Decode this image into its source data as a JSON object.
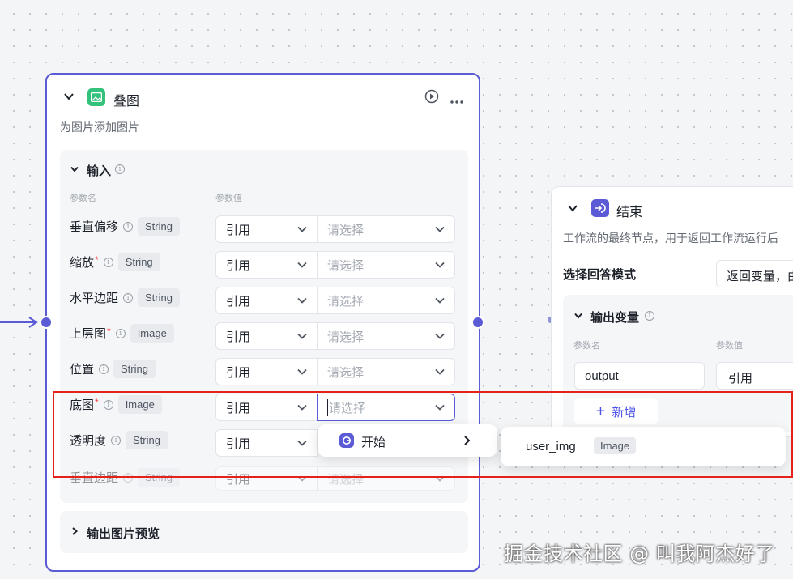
{
  "overlay_node": {
    "title": "叠图",
    "description": "为图片添加图片",
    "input_section": {
      "title": "输入",
      "col_param_name": "参数名",
      "col_param_value": "参数值",
      "rows": [
        {
          "name": "垂直偏移",
          "required": false,
          "type": "String",
          "mode": "引用",
          "placeholder": "请选择"
        },
        {
          "name": "缩放",
          "required": true,
          "type": "String",
          "mode": "引用",
          "placeholder": "请选择"
        },
        {
          "name": "水平边距",
          "required": false,
          "type": "String",
          "mode": "引用",
          "placeholder": "请选择"
        },
        {
          "name": "上层图",
          "required": true,
          "type": "Image",
          "mode": "引用",
          "placeholder": "请选择"
        },
        {
          "name": "位置",
          "required": false,
          "type": "String",
          "mode": "引用",
          "placeholder": "请选择"
        },
        {
          "name": "底图",
          "required": true,
          "type": "Image",
          "mode": "引用",
          "placeholder": "请选择"
        },
        {
          "name": "透明度",
          "required": false,
          "type": "String",
          "mode": "引用",
          "placeholder": ""
        },
        {
          "name": "垂直边距",
          "required": false,
          "type": "String",
          "mode": "引用",
          "placeholder": "请选择"
        }
      ],
      "required_mark": "*"
    },
    "preview_section": {
      "title": "输出图片预览"
    }
  },
  "end_node": {
    "title": "结束",
    "description": "工作流的最终节点，用于返回工作流运行后",
    "answer_mode_label": "选择回答模式",
    "answer_mode_value": "返回变量，由",
    "output_section": {
      "title": "输出变量",
      "col_param_name": "参数名",
      "col_param_value": "参数值",
      "row": {
        "name": "output",
        "mode": "引用"
      },
      "add_label": "新增",
      "add_icon": "+"
    }
  },
  "dropdown": {
    "node_item": "开始",
    "variable": {
      "name": "user_img",
      "type": "Image"
    }
  },
  "watermark": "掘金技术社区 @ 叫我阿杰好了",
  "colors": {
    "accent": "#5b5bd6",
    "highlight": "#e4221b",
    "node_icon_green": "#34c17b"
  }
}
